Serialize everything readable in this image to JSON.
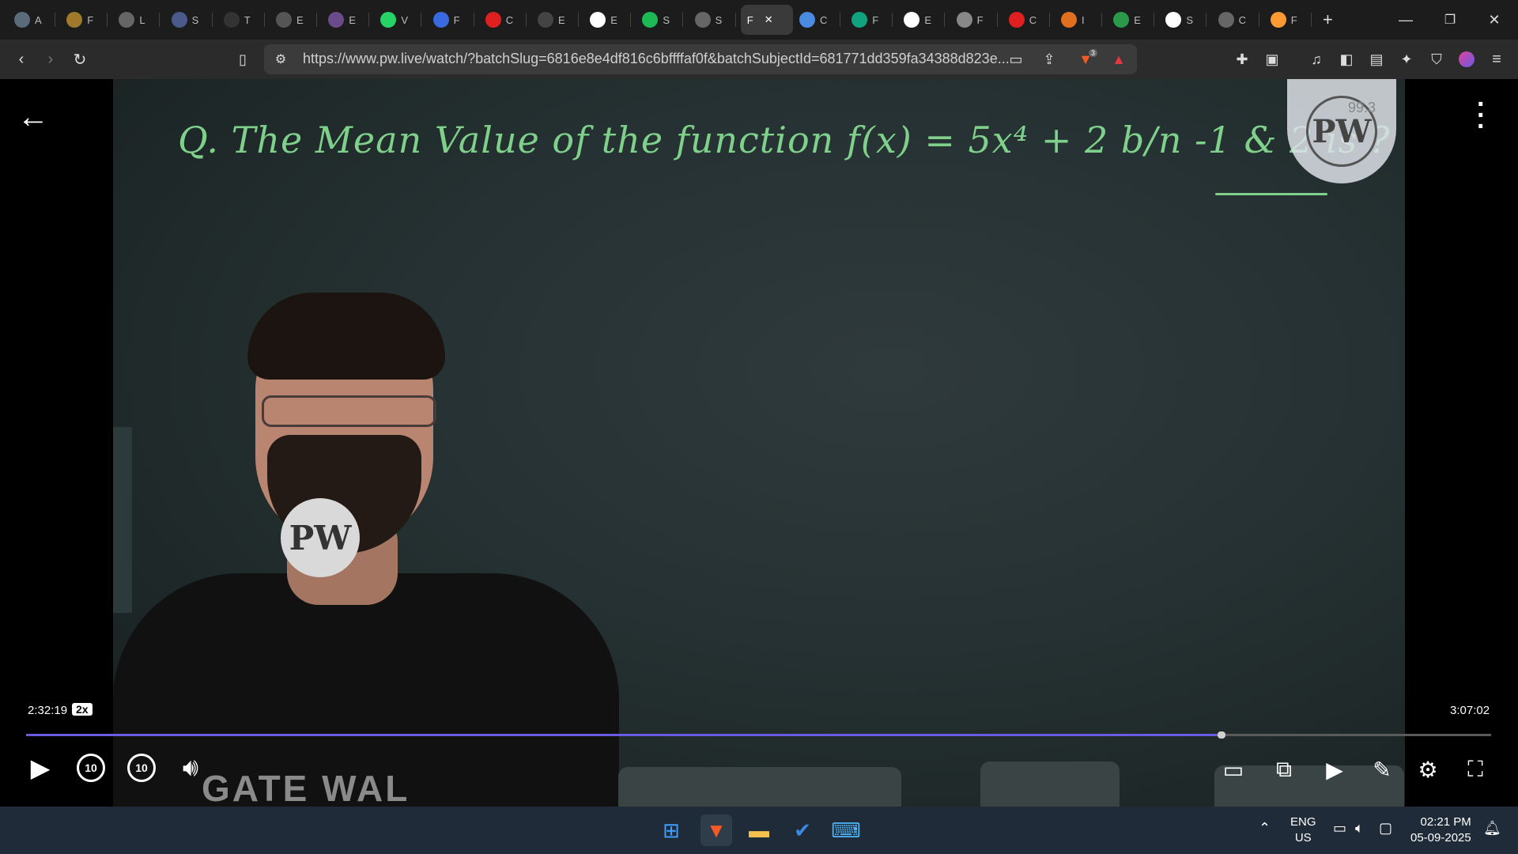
{
  "browser": {
    "tabs": [
      {
        "letter": "A",
        "favicon": "chat-icon",
        "color": "#5a6b7a"
      },
      {
        "letter": "F",
        "favicon": "coin-icon",
        "color": "#a07a2a"
      },
      {
        "letter": "L",
        "favicon": "globe-icon",
        "color": "#666666"
      },
      {
        "letter": "S",
        "favicon": "site-icon",
        "color": "#4a5a8a"
      },
      {
        "letter": "T",
        "favicon": "w3-icon",
        "color": "#333333"
      },
      {
        "letter": "E",
        "favicon": "box-icon",
        "color": "#555555"
      },
      {
        "letter": "E",
        "favicon": "purple-icon",
        "color": "#6a4a8a"
      },
      {
        "letter": "V",
        "favicon": "whatsapp-icon",
        "color": "#25d366"
      },
      {
        "letter": "F",
        "favicon": "bookmark-icon",
        "color": "#3a6ae0"
      },
      {
        "letter": "C",
        "favicon": "youtube-icon",
        "color": "#e02020"
      },
      {
        "letter": "E",
        "favicon": "grid-icon",
        "color": "#444444"
      },
      {
        "letter": "E",
        "favicon": "google-icon",
        "color": "#ffffff"
      },
      {
        "letter": "S",
        "favicon": "spotify-icon",
        "color": "#1db954"
      },
      {
        "letter": "S",
        "favicon": "globe-icon",
        "color": "#666666"
      },
      {
        "letter": "F",
        "favicon": "",
        "color": ""
      },
      {
        "letter": "C",
        "favicon": "gemini-icon",
        "color": "#4a8ae0"
      },
      {
        "letter": "F",
        "favicon": "chatgpt-icon",
        "color": "#10a37f"
      },
      {
        "letter": "E",
        "favicon": "google-icon",
        "color": "#ffffff"
      },
      {
        "letter": "F",
        "favicon": "monitor-icon",
        "color": "#888888"
      },
      {
        "letter": "C",
        "favicon": "youtube-icon",
        "color": "#e02020"
      },
      {
        "letter": "I",
        "favicon": "burger-icon",
        "color": "#e07020"
      },
      {
        "letter": "E",
        "favicon": "chart-icon",
        "color": "#2a9a4a"
      },
      {
        "letter": "S",
        "favicon": "wikipedia-icon",
        "color": "#ffffff"
      },
      {
        "letter": "C",
        "favicon": "globe-icon",
        "color": "#666666"
      },
      {
        "letter": "F",
        "favicon": "india-flag-icon",
        "color": "#ff9933"
      }
    ],
    "active_tab_index": 14,
    "close_glyph": "✕",
    "new_tab_glyph": "+",
    "url": "https://www.pw.live/watch/?batchSlug=6816e8e4df816c6bffffaf0f&batchSubjectId=681771dd359fa34388d823e...",
    "url_domain": "www.pw.live",
    "brave_badge": "3"
  },
  "video": {
    "question_text": "Q. The Mean Value of the function f(x) = 5x⁴ + 2  b/n  -1 & 2  is ?",
    "watermark_logo": "PW",
    "watermark_percent": "99.3",
    "shirt_logo": "PW",
    "backdrop_text": "GATE WAL",
    "elapsed": "2:32:19",
    "speed": "2x",
    "duration": "3:07:02",
    "progress_fraction": 0.8133,
    "skip_back_label": "10",
    "skip_forward_label": "10",
    "accent_color": "#6a5ce0"
  },
  "taskbar": {
    "language_line1": "ENG",
    "language_line2": "US",
    "time": "02:21 PM",
    "date": "05-09-2025"
  }
}
